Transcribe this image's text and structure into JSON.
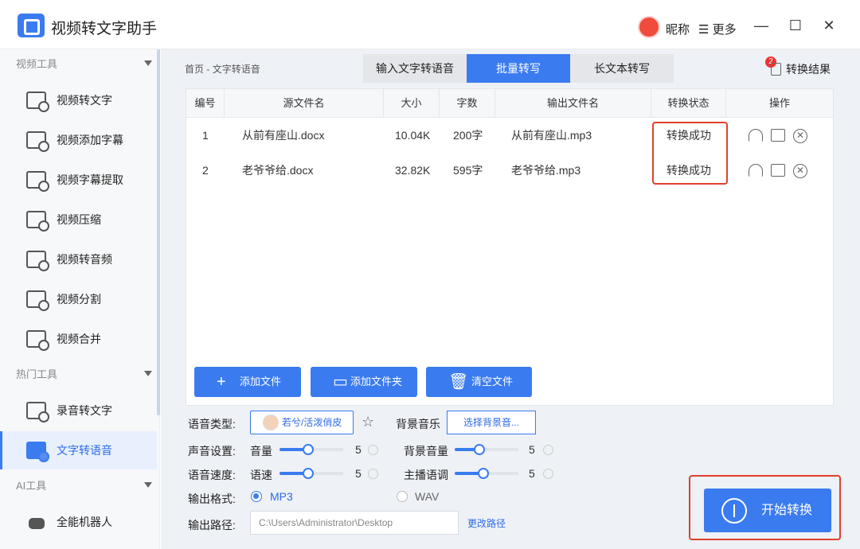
{
  "app": {
    "title": "视频转文字助手",
    "nickname": "昵称",
    "more": "更多"
  },
  "window": {
    "minimize": "—",
    "maximize": "☐",
    "close": "✕"
  },
  "sidebar": {
    "groups": [
      {
        "title": "视频工具",
        "items": [
          "视频转文字",
          "视频添加字幕",
          "视频字幕提取",
          "视频压缩",
          "视频转音频",
          "视频分割",
          "视频合并"
        ]
      },
      {
        "title": "热门工具",
        "items": [
          "录音转文字",
          "文字转语音"
        ]
      },
      {
        "title": "AI工具",
        "items": [
          "全能机器人"
        ]
      }
    ],
    "active_item": "文字转语音"
  },
  "breadcrumb": {
    "home": "首页",
    "sep": "-",
    "current": "文字转语音"
  },
  "tabs": [
    "输入文字转语音",
    "批量转写",
    "长文本转写"
  ],
  "active_tab": "批量转写",
  "result": {
    "label": "转换结果",
    "badge": "2"
  },
  "table": {
    "headers": [
      "编号",
      "源文件名",
      "大小",
      "字数",
      "输出文件名",
      "转换状态",
      "操作"
    ],
    "rows": [
      {
        "no": "1",
        "source": "从前有座山.docx",
        "size": "10.04K",
        "words": "200字",
        "output": "从前有座山.mp3",
        "status": "转换成功"
      },
      {
        "no": "2",
        "source": "老爷爷给.docx",
        "size": "32.82K",
        "words": "595字",
        "output": "老爷爷给.mp3",
        "status": "转换成功"
      }
    ]
  },
  "buttons": {
    "add_file": "添加文件",
    "add_folder": "添加文件夹",
    "clear": "清空文件"
  },
  "settings": {
    "voice_type_label": "语音类型:",
    "voice": "若兮/活泼俏皮",
    "bgm_label": "背景音乐",
    "bgm_button": "选择背景音...",
    "sound_label": "声音设置:",
    "volume_label": "音量",
    "volume_value": "5",
    "bg_volume_label": "背景音量",
    "bg_volume_value": "5",
    "speed_label": "语音速度:",
    "speed_name": "语速",
    "speed_value": "5",
    "tone_label": "主播语调",
    "tone_value": "5",
    "format_label": "输出格式:",
    "format_mp3": "MP3",
    "format_wav": "WAV",
    "selected_format": "MP3",
    "path_label": "输出路径:",
    "path_value": "C:\\Users\\Administrator\\Desktop",
    "change_path": "更改路径"
  },
  "start_button": "开始转换",
  "colors": {
    "accent": "#3a7bf0",
    "highlight": "#e0402e"
  }
}
